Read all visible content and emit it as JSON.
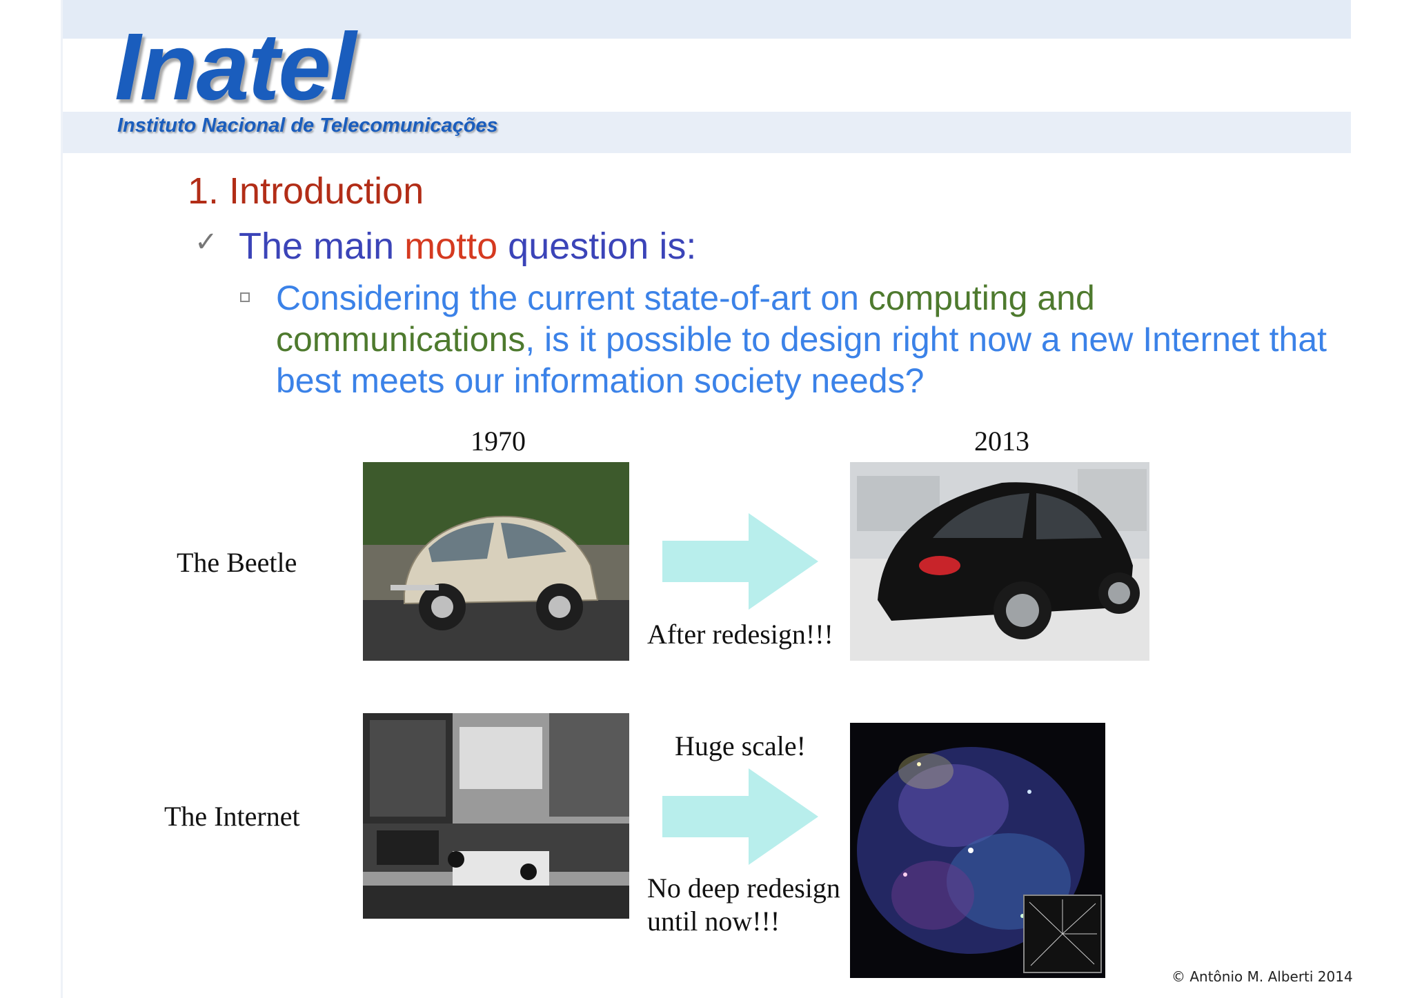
{
  "header": {
    "logo_text": "Inatel",
    "logo_subtitle": "Instituto Nacional de Telecomunicações",
    "brand_color": "#1a5dbd"
  },
  "slide": {
    "section_title": "1. Introduction",
    "bullet_1": {
      "part1": "The main ",
      "part2": "motto",
      "part3": " question is:"
    },
    "bullet_2": {
      "part1": "Considering the current state-of-art on ",
      "part2": "computing and communications",
      "part3": ", is it possible to design right now a new Internet that best meets our information society needs?"
    }
  },
  "comparison": {
    "year_left": "1970",
    "year_right": "2013",
    "row_beetle": {
      "label": "The Beetle",
      "caption": "After redesign!!!",
      "left_image": "vintage beetle car photo",
      "right_image": "2013 beetle car photo"
    },
    "row_internet": {
      "label": "The Internet",
      "caption_top": "Huge scale!",
      "caption_bottom": "No deep redesign until now!!!",
      "left_image": "1970 computer room photo",
      "right_image": "internet map visualization"
    },
    "arrow_color": "#b8eeec"
  },
  "footer": {
    "copyright": "© Antônio M. Alberti 2014"
  }
}
